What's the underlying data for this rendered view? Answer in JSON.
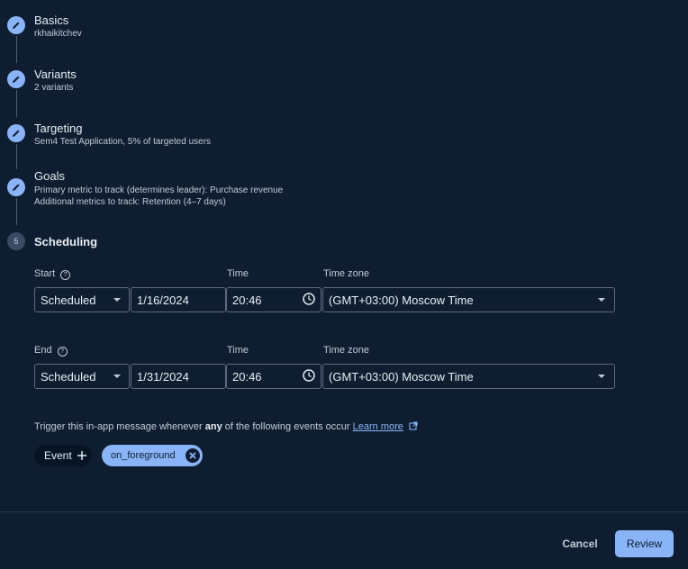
{
  "steps": [
    {
      "title": "Basics",
      "subtitle": "rkhaikitchev"
    },
    {
      "title": "Variants",
      "subtitle": "2 variants"
    },
    {
      "title": "Targeting",
      "subtitle": "Sem4 Test Application, 5% of targeted users"
    },
    {
      "title": "Goals",
      "subtitle_lines": [
        "Primary metric to track (determines leader): Purchase revenue",
        "Additional metrics to track: Retention (4–7 days)"
      ]
    },
    {
      "title": "Scheduling",
      "number": "5"
    }
  ],
  "scheduling": {
    "start": {
      "label": "Start",
      "mode": "Scheduled",
      "date": "1/16/2024",
      "time_label": "Time",
      "time": "20:46",
      "tz_label": "Time zone",
      "timezone": "(GMT+03:00) Moscow Time"
    },
    "end": {
      "label": "End",
      "mode": "Scheduled",
      "date": "1/31/2024",
      "time_label": "Time",
      "time": "20:46",
      "tz_label": "Time zone",
      "timezone": "(GMT+03:00) Moscow Time"
    }
  },
  "trigger": {
    "text_before": "Trigger this in-app message whenever ",
    "bold": "any",
    "text_after": " of the following events occur ",
    "learn_more": "Learn more"
  },
  "chips": {
    "event_label": "Event",
    "event_value": "on_foreground"
  },
  "footer": {
    "cancel": "Cancel",
    "review": "Review"
  },
  "help_glyph": "?",
  "colors": {
    "background": "#0e1e30",
    "accent": "#8ab4f8"
  }
}
